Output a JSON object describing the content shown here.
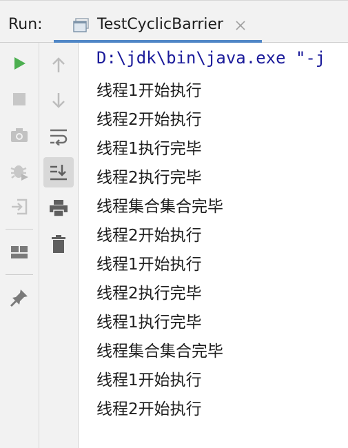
{
  "header": {
    "run_label": "Run:",
    "tab_title": "TestCyclicBarrier",
    "tab_icon": "console-window-icon",
    "tab_close_icon": "close-icon"
  },
  "toolbar_left": [
    {
      "name": "rerun-icon",
      "color": "#4caf50"
    },
    {
      "name": "stop-icon"
    },
    {
      "name": "camera-icon"
    },
    {
      "name": "debug-bug-icon"
    },
    {
      "name": "exit-icon"
    },
    {
      "name": "layout-icon"
    },
    {
      "name": "pin-icon"
    }
  ],
  "toolbar_right": [
    {
      "name": "arrow-up-icon"
    },
    {
      "name": "arrow-down-icon"
    },
    {
      "name": "soft-wrap-icon"
    },
    {
      "name": "scroll-to-end-icon",
      "active": true
    },
    {
      "name": "print-icon"
    },
    {
      "name": "trash-icon"
    }
  ],
  "console": {
    "command": "D:\\jdk\\bin\\java.exe \"-j",
    "lines": [
      "线程1开始执行",
      "线程2开始执行",
      "线程1执行完毕",
      "线程2执行完毕",
      "线程集合集合完毕",
      "线程2开始执行",
      "线程1开始执行",
      "线程2执行完毕",
      "线程1执行完毕",
      "线程集合集合完毕",
      "线程1开始执行",
      "线程2开始执行"
    ]
  },
  "colors": {
    "command_text": "#1a1a9a",
    "tab_underline": "#4f86c6",
    "toolbar_bg": "#f2f2f2"
  }
}
